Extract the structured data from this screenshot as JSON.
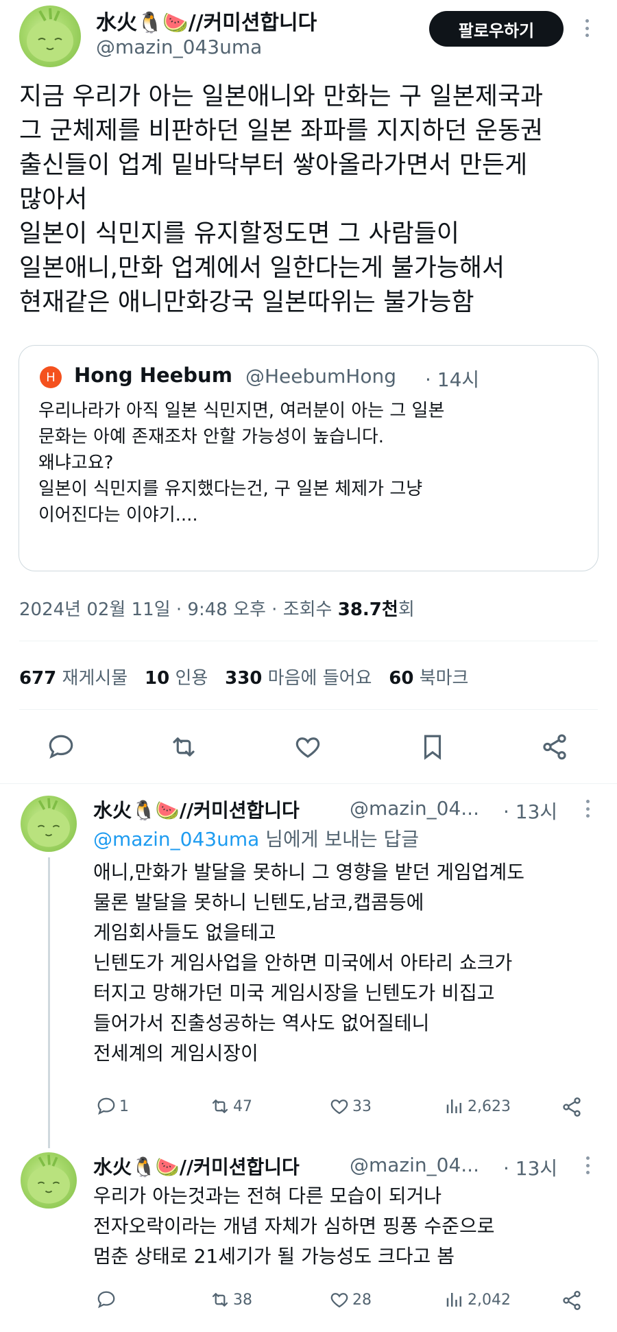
{
  "post": {
    "author": "水火🐧🍉//커미션합니다",
    "handle": "@mazin_043uma",
    "follow_label": "팔로우하기",
    "lines": [
      "지금 우리가 아는 일본애니와 만화는 구 일본제국과",
      "그 군체제를 비판하던 일본 좌파를 지지하던 운동권",
      "출신들이 업계 밑바닥부터 쌓아올라가면서 만든게",
      "많아서",
      "일본이 식민지를 유지할정도면 그 사람들이",
      "일본애니,만화 업계에서 일한다는게 불가능해서",
      "현재같은 애니만화강국 일본따위는 불가능함"
    ],
    "quote": {
      "badge": "H",
      "author": "Hong Heebum",
      "handle": "@HeebumHong",
      "time": "· 14시",
      "lines": [
        "우리나라가 아직 일본 식민지면, 여러분이 아는 그 일본",
        "문화는 아예 존재조차 안할 가능성이 높습니다.",
        "왜냐고요?",
        "일본이 식민지를 유지했다는건, 구 일본 체제가 그냥",
        "이어진다는 이야기...."
      ]
    },
    "meta": {
      "date": "2024년 02월 11일 · 9:48 오후 · 조회수 ",
      "views": "38.7천",
      "views_suffix": "회"
    },
    "stats": {
      "retweets_count": "677",
      "retweets_label": "재게시물",
      "quotes_count": "10",
      "quotes_label": "인용",
      "likes_count": "330",
      "likes_label": "마음에 들어요",
      "bookmarks_count": "60",
      "bookmarks_label": "북마크"
    }
  },
  "replies": [
    {
      "author": "水火🐧🍉//커미션합니다",
      "handle": "@mazin_04...",
      "time": "· 13시",
      "replying_to": "@mazin_043uma",
      "replying_suffix": " 님에게 보내는 답글",
      "lines": [
        "애니,만화가 발달을 못하니 그 영향을 받던 게임업계도",
        "물론 발달을 못하니 닌텐도,남코,캡콤등에",
        "게임회사들도 없을테고",
        "닌텐도가 게임사업을 안하면 미국에서 아타리 쇼크가",
        "터지고 망해가던 미국 게임시장을 닌텐도가 비집고",
        "들어가서 진출성공하는 역사도 없어질테니",
        "전세계의 게임시장이"
      ],
      "replies": "1",
      "retweets": "47",
      "likes": "33",
      "views": "2,623"
    },
    {
      "author": "水火🐧🍉//커미션합니다",
      "handle": "@mazin_04...",
      "time": "· 13시",
      "lines": [
        "우리가 아는것과는 전혀 다른 모습이 되거나",
        "전자오락이라는 개념 자체가 심하면 핑퐁 수준으로",
        "멈춘 상태로 21세기가 될 가능성도 크다고 봄"
      ],
      "replies": "",
      "retweets": "38",
      "likes": "28",
      "views": "2,042"
    }
  ]
}
